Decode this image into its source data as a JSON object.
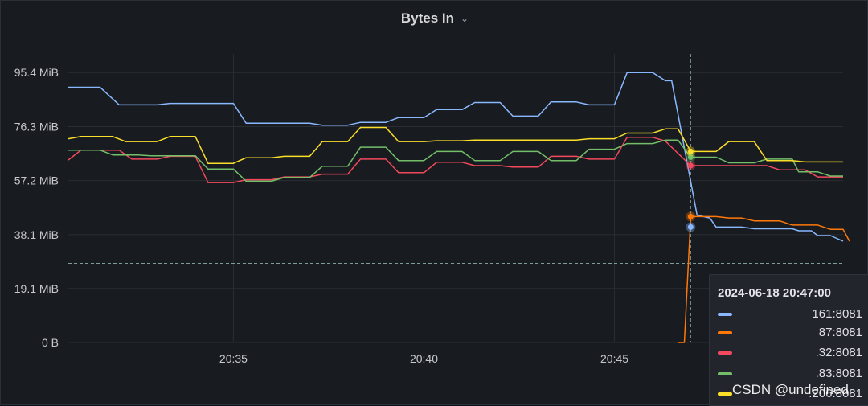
{
  "panel": {
    "title": "Bytes In",
    "title_icon": "chevron-down-icon"
  },
  "tooltip": {
    "time": "2024-06-18 20:47:00",
    "rows": [
      {
        "label": "161:8081",
        "color": "#8ab8ff"
      },
      {
        "label": "87:8081",
        "color": "#ff780a"
      },
      {
        "label": ".32:8081",
        "color": "#f2495c"
      },
      {
        "label": ".83:8081",
        "color": "#73bf69"
      },
      {
        "label": ".206:8081",
        "color": "#fade2a"
      }
    ]
  },
  "watermark": "CSDN @undefined",
  "chart_data": {
    "type": "line",
    "title": "Bytes In",
    "xlabel": "",
    "ylabel": "",
    "x_ticks": [
      "20:35",
      "20:40",
      "20:45"
    ],
    "y_ticks": [
      "0 B",
      "19.1 MiB",
      "38.1 MiB",
      "57.2 MiB",
      "76.3 MiB",
      "95.4 MiB"
    ],
    "ylim": [
      0,
      102
    ],
    "y_unit": "MiB",
    "xlim": [
      "20:30:40",
      "20:51:00"
    ],
    "threshold": 28,
    "crosshair_time": "20:47:00",
    "grid": true,
    "legend": "tooltip",
    "series": [
      {
        "name": "161:8081",
        "color": "#8ab8ff",
        "points": [
          [
            "20:30:40",
            90.2
          ],
          [
            "20:31:30",
            90.2
          ],
          [
            "20:32:00",
            84.0
          ],
          [
            "20:33:00",
            84.0
          ],
          [
            "20:33:20",
            84.5
          ],
          [
            "20:35:00",
            84.5
          ],
          [
            "20:35:20",
            77.5
          ],
          [
            "20:37:00",
            77.5
          ],
          [
            "20:37:20",
            76.8
          ],
          [
            "20:38:00",
            76.8
          ],
          [
            "20:38:20",
            77.8
          ],
          [
            "20:39:00",
            77.8
          ],
          [
            "20:39:20",
            79.5
          ],
          [
            "20:40:00",
            79.5
          ],
          [
            "20:40:20",
            82.3
          ],
          [
            "20:41:00",
            82.3
          ],
          [
            "20:41:20",
            84.8
          ],
          [
            "20:42:00",
            84.8
          ],
          [
            "20:42:20",
            80.0
          ],
          [
            "20:43:00",
            80.0
          ],
          [
            "20:43:20",
            85.0
          ],
          [
            "20:44:00",
            85.0
          ],
          [
            "20:44:20",
            84.0
          ],
          [
            "20:45:00",
            84.0
          ],
          [
            "20:45:20",
            95.4
          ],
          [
            "20:46:00",
            95.4
          ],
          [
            "20:46:20",
            92.5
          ],
          [
            "20:46:30",
            92.5
          ],
          [
            "20:47:10",
            45.0
          ],
          [
            "20:47:30",
            44.0
          ],
          [
            "20:47:40",
            40.8
          ],
          [
            "20:48:20",
            40.8
          ],
          [
            "20:48:40",
            40.2
          ],
          [
            "20:49:40",
            40.2
          ],
          [
            "20:49:50",
            39.5
          ],
          [
            "20:50:10",
            39.5
          ],
          [
            "20:50:20",
            37.8
          ],
          [
            "20:50:40",
            37.8
          ],
          [
            "20:51:00",
            35.8
          ]
        ]
      },
      {
        "name": "87:8081",
        "color": "#ff780a",
        "points": [
          [
            "20:46:40",
            0
          ],
          [
            "20:46:50",
            0
          ],
          [
            "20:47:00",
            44.5
          ],
          [
            "20:47:40",
            44.5
          ],
          [
            "20:48:00",
            44.0
          ],
          [
            "20:48:20",
            44.0
          ],
          [
            "20:48:40",
            43.0
          ],
          [
            "20:49:20",
            43.0
          ],
          [
            "20:49:40",
            41.5
          ],
          [
            "20:50:20",
            41.5
          ],
          [
            "20:50:40",
            40.0
          ],
          [
            "20:51:00",
            40.0
          ],
          [
            "20:51:10",
            35.8
          ]
        ]
      },
      {
        "name": ".32:8081",
        "color": "#f2495c",
        "points": [
          [
            "20:30:40",
            64.5
          ],
          [
            "20:31:00",
            68.0
          ],
          [
            "20:31:30",
            68.0
          ],
          [
            "20:32:00",
            68.0
          ],
          [
            "20:32:20",
            64.8
          ],
          [
            "20:33:00",
            64.8
          ],
          [
            "20:33:20",
            65.8
          ],
          [
            "20:34:00",
            65.8
          ],
          [
            "20:34:20",
            56.5
          ],
          [
            "20:35:00",
            56.5
          ],
          [
            "20:35:20",
            57.5
          ],
          [
            "20:36:00",
            57.5
          ],
          [
            "20:36:20",
            58.5
          ],
          [
            "20:37:00",
            58.5
          ],
          [
            "20:37:20",
            59.5
          ],
          [
            "20:38:00",
            59.5
          ],
          [
            "20:38:20",
            64.8
          ],
          [
            "20:39:00",
            64.8
          ],
          [
            "20:39:20",
            60.0
          ],
          [
            "20:40:00",
            60.0
          ],
          [
            "20:40:20",
            63.7
          ],
          [
            "20:41:00",
            63.7
          ],
          [
            "20:41:20",
            62.5
          ],
          [
            "20:42:00",
            62.5
          ],
          [
            "20:42:20",
            62.0
          ],
          [
            "20:43:00",
            62.0
          ],
          [
            "20:43:20",
            65.8
          ],
          [
            "20:44:00",
            65.8
          ],
          [
            "20:44:20",
            64.8
          ],
          [
            "20:45:00",
            64.8
          ],
          [
            "20:45:20",
            72.5
          ],
          [
            "20:46:00",
            72.5
          ],
          [
            "20:46:20",
            71.2
          ],
          [
            "20:47:00",
            62.5
          ],
          [
            "20:47:40",
            62.5
          ],
          [
            "20:48:00",
            62.5
          ],
          [
            "20:49:00",
            62.5
          ],
          [
            "20:49:20",
            61.0
          ],
          [
            "20:50:00",
            61.0
          ],
          [
            "20:50:20",
            58.5
          ],
          [
            "20:51:00",
            58.5
          ]
        ]
      },
      {
        "name": ".83:8081",
        "color": "#73bf69",
        "points": [
          [
            "20:30:40",
            68.0
          ],
          [
            "20:31:30",
            68.0
          ],
          [
            "20:31:50",
            66.3
          ],
          [
            "20:32:30",
            66.3
          ],
          [
            "20:32:50",
            66.0
          ],
          [
            "20:33:20",
            66.0
          ],
          [
            "20:34:00",
            66.0
          ],
          [
            "20:34:20",
            61.3
          ],
          [
            "20:35:00",
            61.3
          ],
          [
            "20:35:20",
            57.0
          ],
          [
            "20:36:00",
            57.0
          ],
          [
            "20:36:20",
            58.3
          ],
          [
            "20:37:00",
            58.3
          ],
          [
            "20:37:20",
            62.3
          ],
          [
            "20:38:00",
            62.3
          ],
          [
            "20:38:20",
            69.0
          ],
          [
            "20:39:00",
            69.0
          ],
          [
            "20:39:20",
            64.3
          ],
          [
            "20:40:00",
            64.3
          ],
          [
            "20:40:20",
            67.5
          ],
          [
            "20:41:00",
            67.5
          ],
          [
            "20:41:20",
            64.3
          ],
          [
            "20:42:00",
            64.3
          ],
          [
            "20:42:20",
            67.5
          ],
          [
            "20:43:00",
            67.5
          ],
          [
            "20:43:20",
            64.3
          ],
          [
            "20:44:00",
            64.3
          ],
          [
            "20:44:20",
            68.3
          ],
          [
            "20:45:00",
            68.3
          ],
          [
            "20:45:20",
            70.3
          ],
          [
            "20:46:00",
            70.3
          ],
          [
            "20:46:20",
            71.5
          ],
          [
            "20:46:40",
            71.5
          ],
          [
            "20:47:00",
            65.5
          ],
          [
            "20:47:40",
            65.5
          ],
          [
            "20:48:00",
            63.5
          ],
          [
            "20:48:40",
            63.5
          ],
          [
            "20:49:00",
            64.8
          ],
          [
            "20:49:40",
            64.8
          ],
          [
            "20:49:50",
            60.3
          ],
          [
            "20:50:20",
            60.3
          ],
          [
            "20:50:40",
            58.8
          ],
          [
            "20:51:00",
            58.8
          ]
        ]
      },
      {
        "name": ".206:8081",
        "color": "#fade2a",
        "points": [
          [
            "20:30:40",
            72.0
          ],
          [
            "20:31:00",
            72.8
          ],
          [
            "20:31:50",
            72.8
          ],
          [
            "20:32:10",
            71.0
          ],
          [
            "20:33:00",
            71.0
          ],
          [
            "20:33:20",
            72.8
          ],
          [
            "20:34:00",
            72.8
          ],
          [
            "20:34:20",
            63.3
          ],
          [
            "20:35:00",
            63.3
          ],
          [
            "20:35:20",
            65.3
          ],
          [
            "20:36:00",
            65.3
          ],
          [
            "20:36:20",
            65.8
          ],
          [
            "20:37:00",
            65.8
          ],
          [
            "20:37:20",
            71.0
          ],
          [
            "20:38:00",
            71.0
          ],
          [
            "20:38:20",
            76.0
          ],
          [
            "20:39:00",
            76.0
          ],
          [
            "20:39:20",
            71.0
          ],
          [
            "20:40:00",
            71.0
          ],
          [
            "20:40:20",
            71.3
          ],
          [
            "20:41:00",
            71.3
          ],
          [
            "20:41:20",
            71.5
          ],
          [
            "20:44:00",
            71.5
          ],
          [
            "20:44:20",
            72.0
          ],
          [
            "20:45:00",
            72.0
          ],
          [
            "20:45:20",
            74.0
          ],
          [
            "20:46:00",
            74.0
          ],
          [
            "20:46:20",
            75.5
          ],
          [
            "20:46:40",
            75.5
          ],
          [
            "20:47:00",
            67.5
          ],
          [
            "20:47:40",
            67.5
          ],
          [
            "20:48:00",
            71.0
          ],
          [
            "20:48:40",
            71.0
          ],
          [
            "20:49:00",
            64.3
          ],
          [
            "20:49:40",
            64.3
          ],
          [
            "20:50:00",
            63.8
          ],
          [
            "20:51:00",
            63.8
          ]
        ]
      }
    ],
    "highlight_points": [
      {
        "series": "161:8081",
        "time": "20:47:00",
        "value": 40.8
      },
      {
        "series": "87:8081",
        "time": "20:47:00",
        "value": 44.5
      },
      {
        "series": ".32:8081",
        "time": "20:47:00",
        "value": 62.5
      },
      {
        "series": ".83:8081",
        "time": "20:47:00",
        "value": 65.5
      },
      {
        "series": ".206:8081",
        "time": "20:47:00",
        "value": 67.5
      }
    ]
  }
}
